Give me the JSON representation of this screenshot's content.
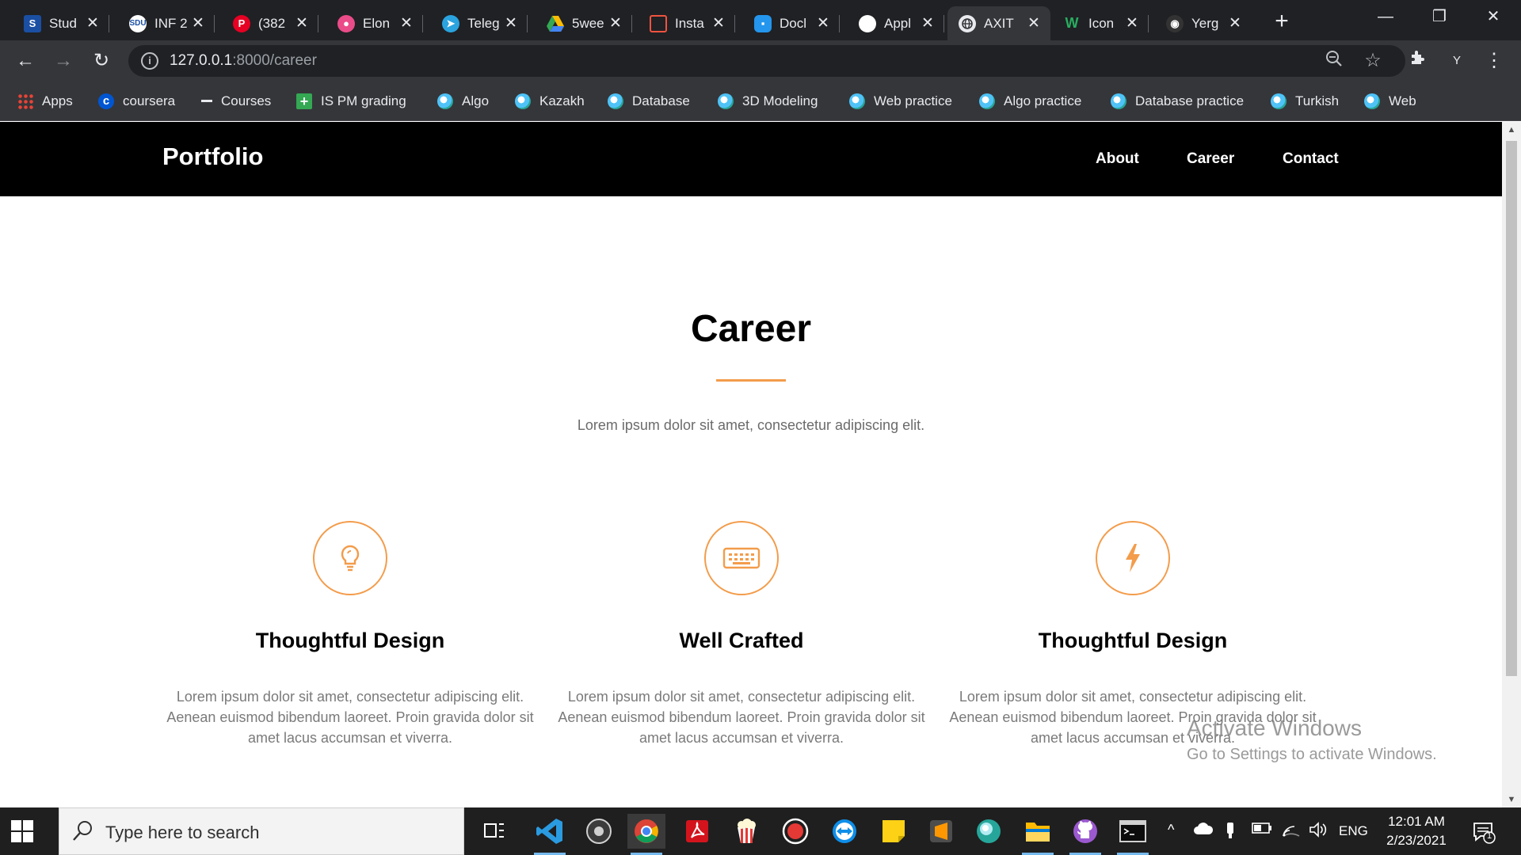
{
  "browser": {
    "tabs": [
      {
        "title": "Stud",
        "icon": "sdu-icon",
        "color": "#1a4fa3"
      },
      {
        "title": "INF 2",
        "icon": "sdu-icon",
        "color": "#ffffff"
      },
      {
        "title": "(382",
        "icon": "pinterest-icon",
        "color": "#e60023"
      },
      {
        "title": "Elon",
        "icon": "dribbble-icon",
        "color": "#ea4c89"
      },
      {
        "title": "Teleg",
        "icon": "telegram-icon",
        "color": "#2aa3df"
      },
      {
        "title": "5wee",
        "icon": "google-drive-icon",
        "color": "#fbbc04"
      },
      {
        "title": "Insta",
        "icon": "laravel-icon",
        "color": "#f05340"
      },
      {
        "title": "Docl",
        "icon": "docker-icon",
        "color": "#2496ed"
      },
      {
        "title": "Appl",
        "icon": "apple-icon",
        "color": "#ffffff"
      },
      {
        "title": "AXIT",
        "icon": "globe-icon",
        "color": "#e8eaed"
      },
      {
        "title": "Icon",
        "icon": "webflow-icon",
        "color": "#27ae60"
      },
      {
        "title": "Yerg",
        "icon": "github-icon",
        "color": "#333333"
      }
    ],
    "active_tab_index": 9,
    "url": {
      "host": "127.0.0.1",
      "path": ":8000/career"
    },
    "profile_initial": "Y",
    "bookmarks": [
      {
        "label": "Apps",
        "icon": "apps-grid-icon"
      },
      {
        "label": "coursera",
        "icon": "coursera-icon"
      },
      {
        "label": "Courses",
        "icon": "courses-icon"
      },
      {
        "label": "IS PM grading",
        "icon": "sheets-plus-icon"
      },
      {
        "label": "Algo",
        "icon": "globe-icon"
      },
      {
        "label": "Kazakh",
        "icon": "globe-icon"
      },
      {
        "label": "Database",
        "icon": "globe-icon"
      },
      {
        "label": "3D Modeling",
        "icon": "globe-icon"
      },
      {
        "label": "Web practice",
        "icon": "globe-icon"
      },
      {
        "label": "Algo practice",
        "icon": "globe-icon"
      },
      {
        "label": "Database practice",
        "icon": "globe-icon"
      },
      {
        "label": "Turkish",
        "icon": "globe-icon"
      },
      {
        "label": "Web",
        "icon": "globe-icon"
      }
    ]
  },
  "site": {
    "brand": "Portfolio",
    "nav": [
      "About",
      "Career",
      "Contact"
    ],
    "section": {
      "title": "Career",
      "subtitle": "Lorem ipsum dolor sit amet, consectetur adipiscing elit."
    },
    "cards": [
      {
        "icon": "lightbulb-icon",
        "title": "Thoughtful Design",
        "text": "Lorem ipsum dolor sit amet, consectetur adipiscing elit. Aenean euismod bibendum laoreet. Proin gravida dolor sit amet lacus accumsan et viverra."
      },
      {
        "icon": "keyboard-icon",
        "title": "Well Crafted",
        "text": "Lorem ipsum dolor sit amet, consectetur adipiscing elit. Aenean euismod bibendum laoreet. Proin gravida dolor sit amet lacus accumsan et viverra."
      },
      {
        "icon": "lightning-icon",
        "title": "Thoughtful Design",
        "text": "Lorem ipsum dolor sit amet, consectetur adipiscing elit. Aenean euismod bibendum laoreet. Proin gravida dolor sit amet lacus accumsan et viverra."
      }
    ],
    "accent_color": "#f39c4b"
  },
  "watermark": {
    "line1": "Activate Windows",
    "line2": "Go to Settings to activate Windows."
  },
  "taskbar": {
    "search_placeholder": "Type here to search",
    "language": "ENG",
    "time": "12:01 AM",
    "date": "2/23/2021",
    "notification_count": "1"
  }
}
